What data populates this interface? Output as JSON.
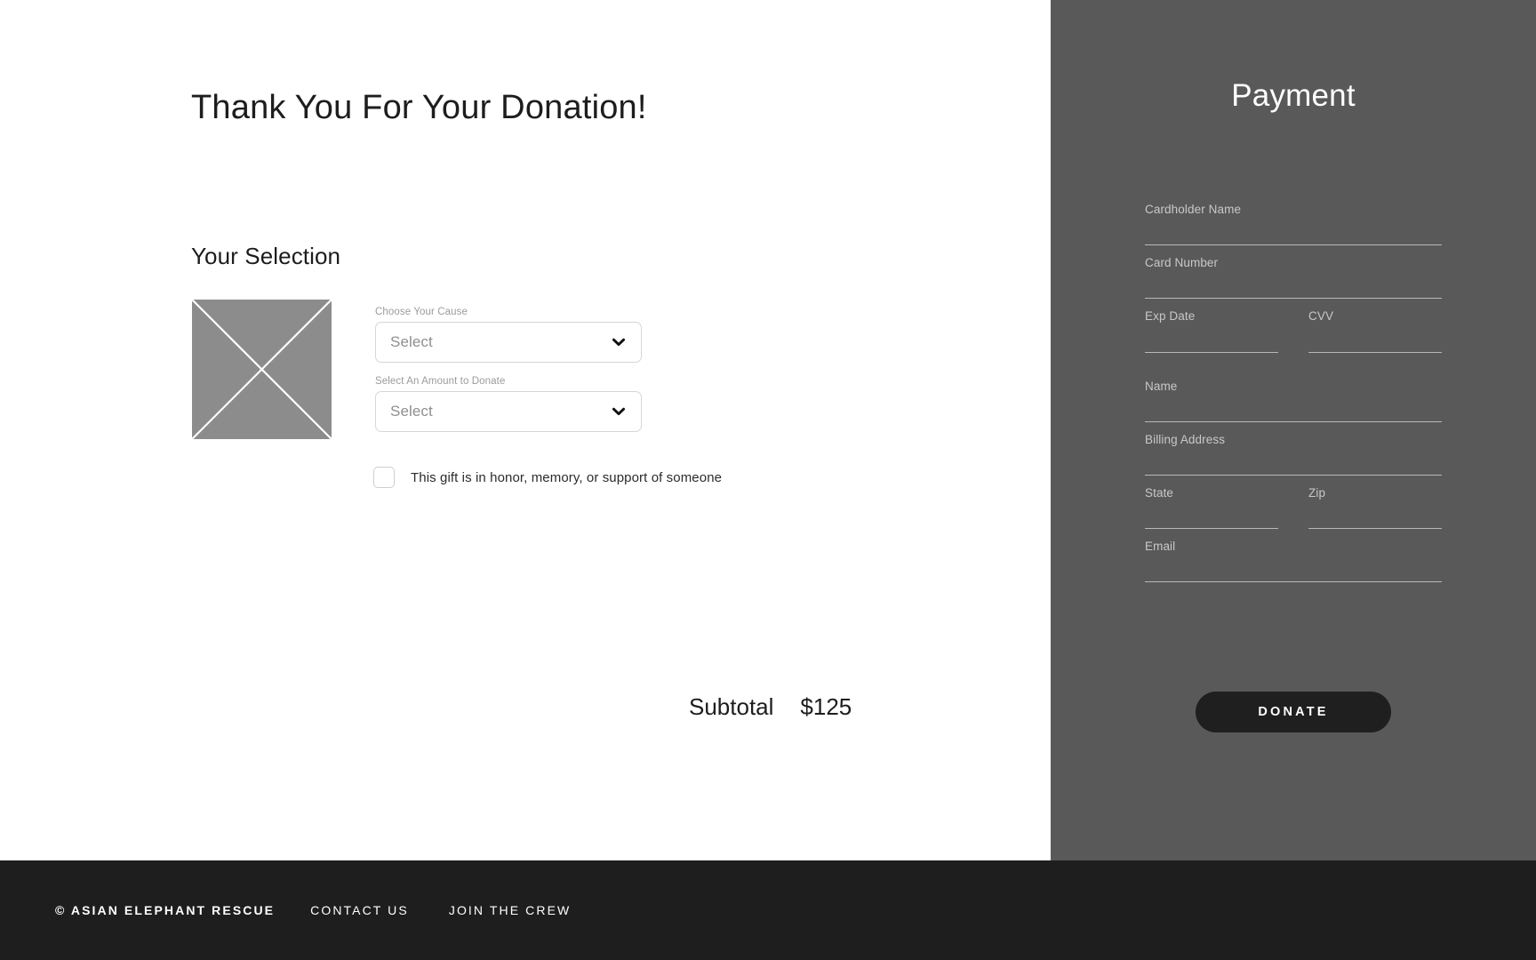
{
  "main": {
    "headline": "Thank You For Your Donation!",
    "section_title": "Your Selection",
    "thumbnail_alt": "image-placeholder",
    "cause": {
      "label": "Choose Your Cause",
      "value": "Select",
      "chevron": "chevron-down-icon"
    },
    "amount": {
      "label": "Select An Amount to Donate",
      "value": "Select",
      "chevron": "chevron-down-icon"
    },
    "honor": {
      "checked": false,
      "label": "This gift is in honor, memory, or support of someone"
    },
    "subtotal": {
      "label": "Subtotal",
      "value": "$125"
    }
  },
  "payment": {
    "title": "Payment",
    "fields": {
      "cardholder_name": {
        "label": "Cardholder Name",
        "value": ""
      },
      "card_number": {
        "label": "Card Number",
        "value": ""
      },
      "exp_date": {
        "label": "Exp Date",
        "value": ""
      },
      "cvv": {
        "label": "CVV",
        "value": ""
      },
      "name": {
        "label": "Name",
        "value": ""
      },
      "billing_address": {
        "label": "Billing Address",
        "value": ""
      },
      "state": {
        "label": "State",
        "value": ""
      },
      "zip": {
        "label": "Zip",
        "value": ""
      },
      "email": {
        "label": "Email",
        "value": ""
      }
    },
    "donate_button": "DONATE"
  },
  "footer": {
    "copyright": "© ASIAN ELEPHANT RESCUE",
    "links": [
      {
        "label": "CONTACT US"
      },
      {
        "label": "JOIN THE CREW"
      }
    ]
  },
  "colors": {
    "panel_gray": "#595959",
    "footer_dark": "#1e1e1e",
    "button_dark": "#1f1f1f",
    "thumb_gray": "#8c8c8c",
    "text_dark": "#1d1d1d",
    "muted": "#9b9b9b"
  }
}
